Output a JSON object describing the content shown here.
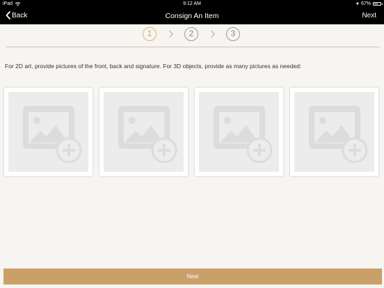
{
  "status_bar": {
    "device": "iPad",
    "time": "9:12 AM",
    "battery": "67%",
    "battery_level": 0.67,
    "icons": [
      "wifi-icon",
      "location-icon",
      "battery-icon"
    ]
  },
  "nav_bar": {
    "back_label": "Back",
    "title": "Consign An Item",
    "next_label": "Next",
    "icons": [
      "chevron-left-icon"
    ]
  },
  "stepper": {
    "steps": [
      "1",
      "2",
      "3"
    ],
    "active_step": "1",
    "colors": {
      "active": "#d9b47f",
      "inactive": "#9a9a9a"
    }
  },
  "instruction": "For 2D art, provide pictures of the front, back and signature.  For 3D objects, provide as many pictures as needed:",
  "photo_slots": [
    {
      "icon": "add-photo-icon"
    },
    {
      "icon": "add-photo-icon"
    },
    {
      "icon": "add-photo-icon"
    },
    {
      "icon": "add-photo-icon"
    }
  ],
  "footer": {
    "next_label": "Next"
  },
  "colors": {
    "accent": "#c9a168",
    "background": "#f7f5f1",
    "nav_background": "#000000"
  }
}
